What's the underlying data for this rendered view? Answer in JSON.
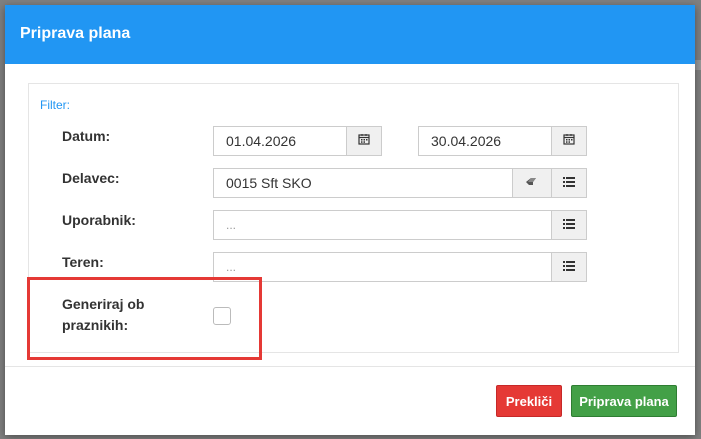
{
  "dialog": {
    "title": "Priprava plana",
    "filter_label": "Filter:",
    "fields": {
      "datum_label": "Datum:",
      "date_from": "01.04.2026",
      "date_to": "30.04.2026",
      "delavec_label": "Delavec:",
      "delavec_value": "0015 Sft SKO",
      "uporabnik_label": "Uporabnik:",
      "uporabnik_placeholder": "...",
      "teren_label": "Teren:",
      "teren_placeholder": "...",
      "generiraj_label_line1": "Generiraj ob",
      "generiraj_label_line2": "praznikih:",
      "generiraj_checked": false
    },
    "buttons": {
      "cancel": "Prekliči",
      "confirm": "Priprava plana"
    }
  },
  "colors": {
    "header": "#2196f3",
    "cancel": "#e53935",
    "confirm": "#43a047",
    "highlight": "#e53935"
  }
}
